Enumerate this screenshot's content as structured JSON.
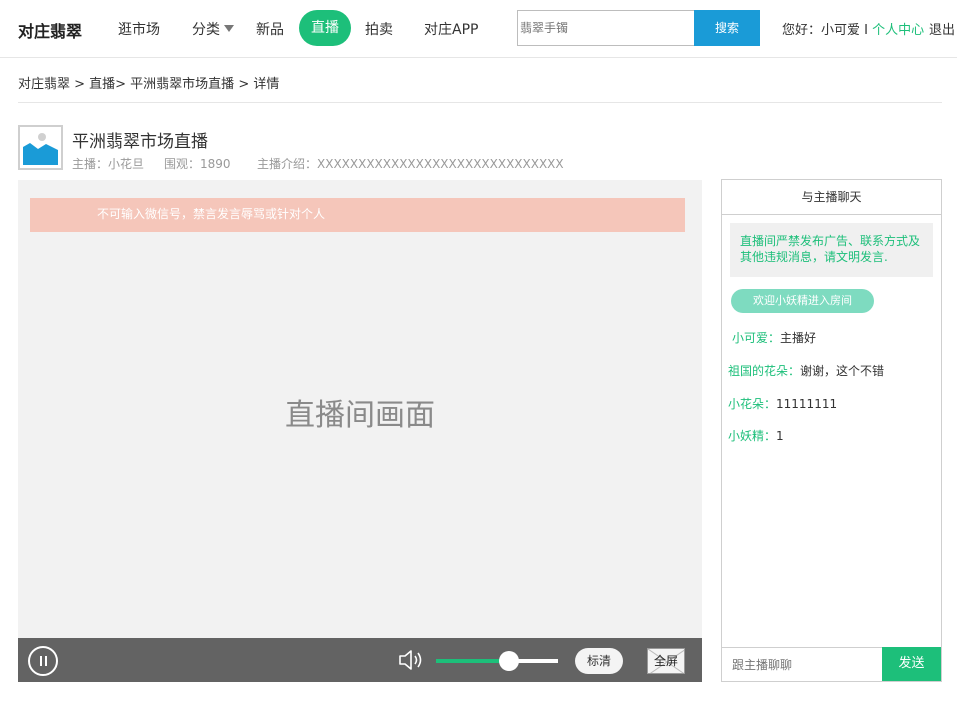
{
  "header": {
    "logo": "对庄翡翠",
    "nav": [
      "逛市场",
      "分类",
      "新品",
      "直播",
      "拍卖",
      "对庄APP"
    ],
    "active_nav": "直播",
    "search_placeholder": "翡翠手镯",
    "search_button": "搜索",
    "greeting": "您好：小可爱 I ",
    "user_center": "个人中心",
    "logout": "退出"
  },
  "breadcrumb": "对庄翡翠 > 直播> 平洲翡翠市场直播 > 详情",
  "room": {
    "title": "平洲翡翠市场直播",
    "host": "主播：小花旦",
    "viewers": "围观：1890",
    "intro": "主播介绍：XXXXXXXXXXXXXXXXXXXXXXXXXXXXXX"
  },
  "video": {
    "notice": "不可输入微信号，禁言发言辱骂或针对个人",
    "placeholder": "直播间画面",
    "volume_level": 0.6,
    "quality": "标清",
    "fullscreen": "全屏"
  },
  "chat": {
    "title": "与主播聊天",
    "rules": "直播间严禁发布广告、联系方式及其他违规消息，请文明发言.",
    "welcome": "欢迎小妖精进入房间",
    "messages": [
      {
        "user": "小可爱：",
        "text": "主播好"
      },
      {
        "user": "祖国的花朵：",
        "text": "谢谢，这个不错"
      },
      {
        "user": "小花朵：",
        "text": "11111111"
      },
      {
        "user": "小妖精：",
        "text": "1"
      }
    ],
    "input_placeholder": "跟主播聊聊",
    "send": "发送"
  },
  "colors": {
    "accent": "#1dbf7a",
    "search_button": "#1a9bd7",
    "notice_bg": "#f5c6ba",
    "control_bar": "#636363"
  }
}
